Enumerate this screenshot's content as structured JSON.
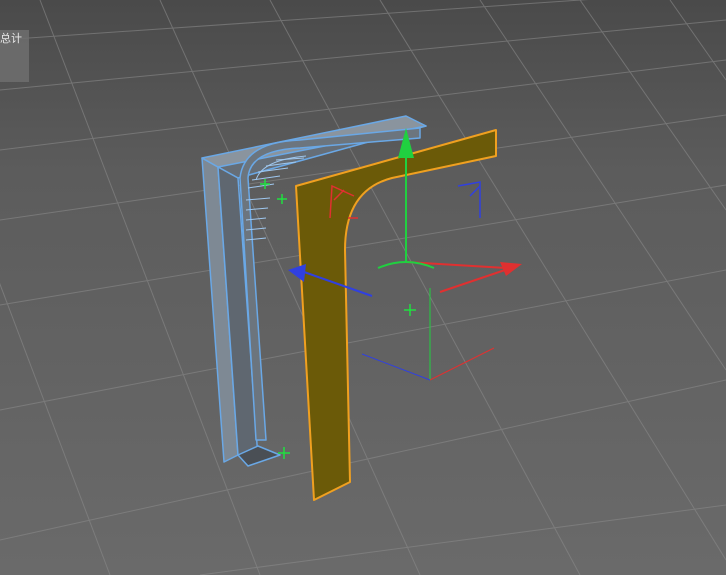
{
  "viewport": {
    "hud_label": "总计",
    "colors": {
      "selection_outline": "#f0a020",
      "selected_fill": "#6b5a08",
      "object_outline": "#5fa0e0",
      "axis_x": "#e03030",
      "axis_y": "#20d040",
      "axis_z": "#3040e0"
    }
  }
}
